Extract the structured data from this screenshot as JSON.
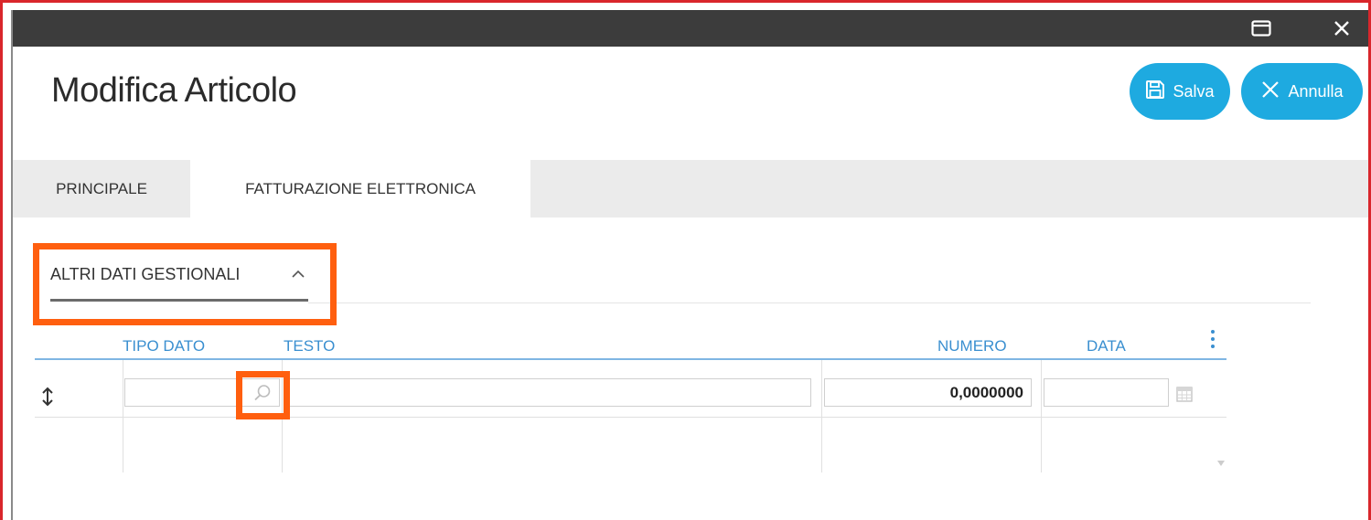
{
  "window": {
    "maximize_icon": "window-maximize-icon",
    "close_icon": "close-icon"
  },
  "page": {
    "title": "Modifica Articolo"
  },
  "toolbar": {
    "save_label": "Salva",
    "save_icon": "floppy-disk-icon",
    "cancel_label": "Annulla",
    "cancel_icon": "x-icon"
  },
  "tabs": [
    {
      "label": "PRINCIPALE",
      "active": false
    },
    {
      "label": "FATTURAZIONE ELETTRONICA",
      "active": true
    }
  ],
  "section": {
    "title": "ALTRI DATI GESTIONALI",
    "expanded": true,
    "chevron_icon": "chevron-up-icon"
  },
  "grid": {
    "columns": [
      "TIPO DATO",
      "TESTO",
      "NUMERO",
      "DATA"
    ],
    "menu_icon": "vertical-ellipsis-icon",
    "rows": [
      {
        "tipo_dato": "",
        "testo": "",
        "numero": "0,0000000",
        "data": ""
      }
    ],
    "row_handle_icon": "up-down-arrow-icon",
    "search_icon": "magnifier-icon",
    "calendar_icon": "calendar-icon"
  },
  "colors": {
    "accent": "#1eaae0",
    "header_text": "#3a8fd0",
    "highlight": "#ff5f0f",
    "titlebar": "#3c3c3c",
    "frame": "#d9262b"
  }
}
